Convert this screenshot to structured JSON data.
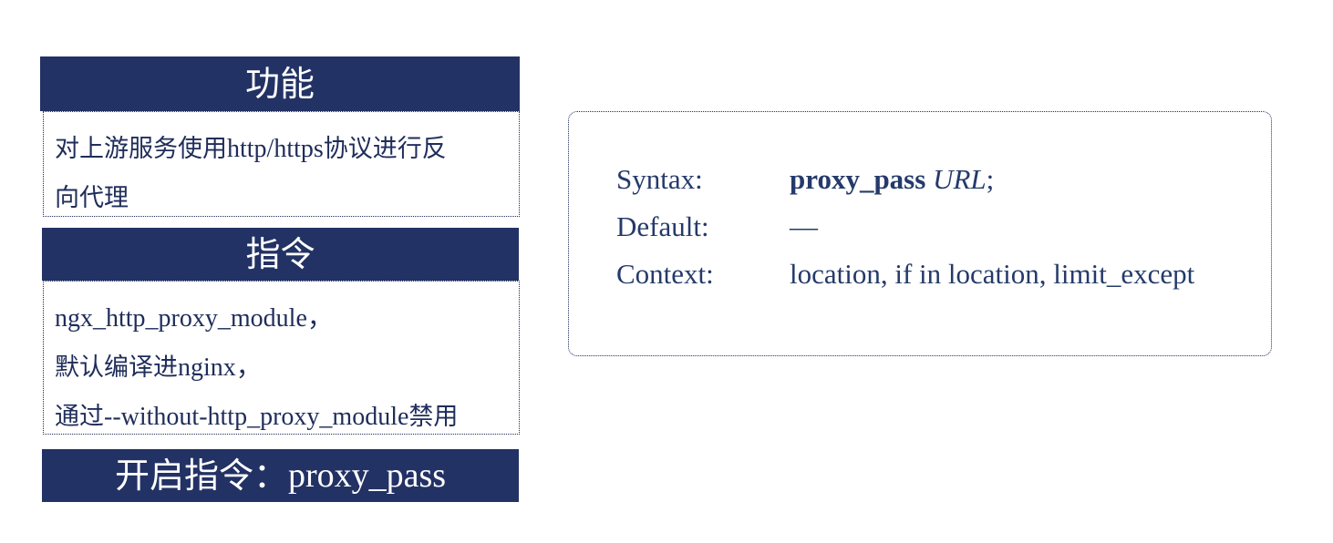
{
  "function_section": {
    "title": "功能",
    "line1_zh_a": "对上游服务使用",
    "line1_en": "http/https",
    "line1_zh_b": "协议进行反",
    "line2": "向代理"
  },
  "directive_section": {
    "title": "指令",
    "line1": "ngx_http_proxy_module，",
    "line2_zh": "默认编译进",
    "line2_en": "nginx，",
    "line3_zh_a": "通过",
    "line3_en": "--without-http_proxy_module",
    "line3_zh_b": "禁用"
  },
  "enable_section": {
    "title_zh": "开启指令：",
    "title_en": "proxy_pass"
  },
  "directive_doc": {
    "syntax_label": "Syntax:",
    "syntax_name": "proxy_pass",
    "syntax_arg": "URL",
    "syntax_end": ";",
    "default_label": "Default:",
    "default_value": "—",
    "context_label": "Context:",
    "context_value": "location, if in location, limit_except"
  },
  "colors": {
    "header_bg": "#233264",
    "text": "#253a6a"
  }
}
